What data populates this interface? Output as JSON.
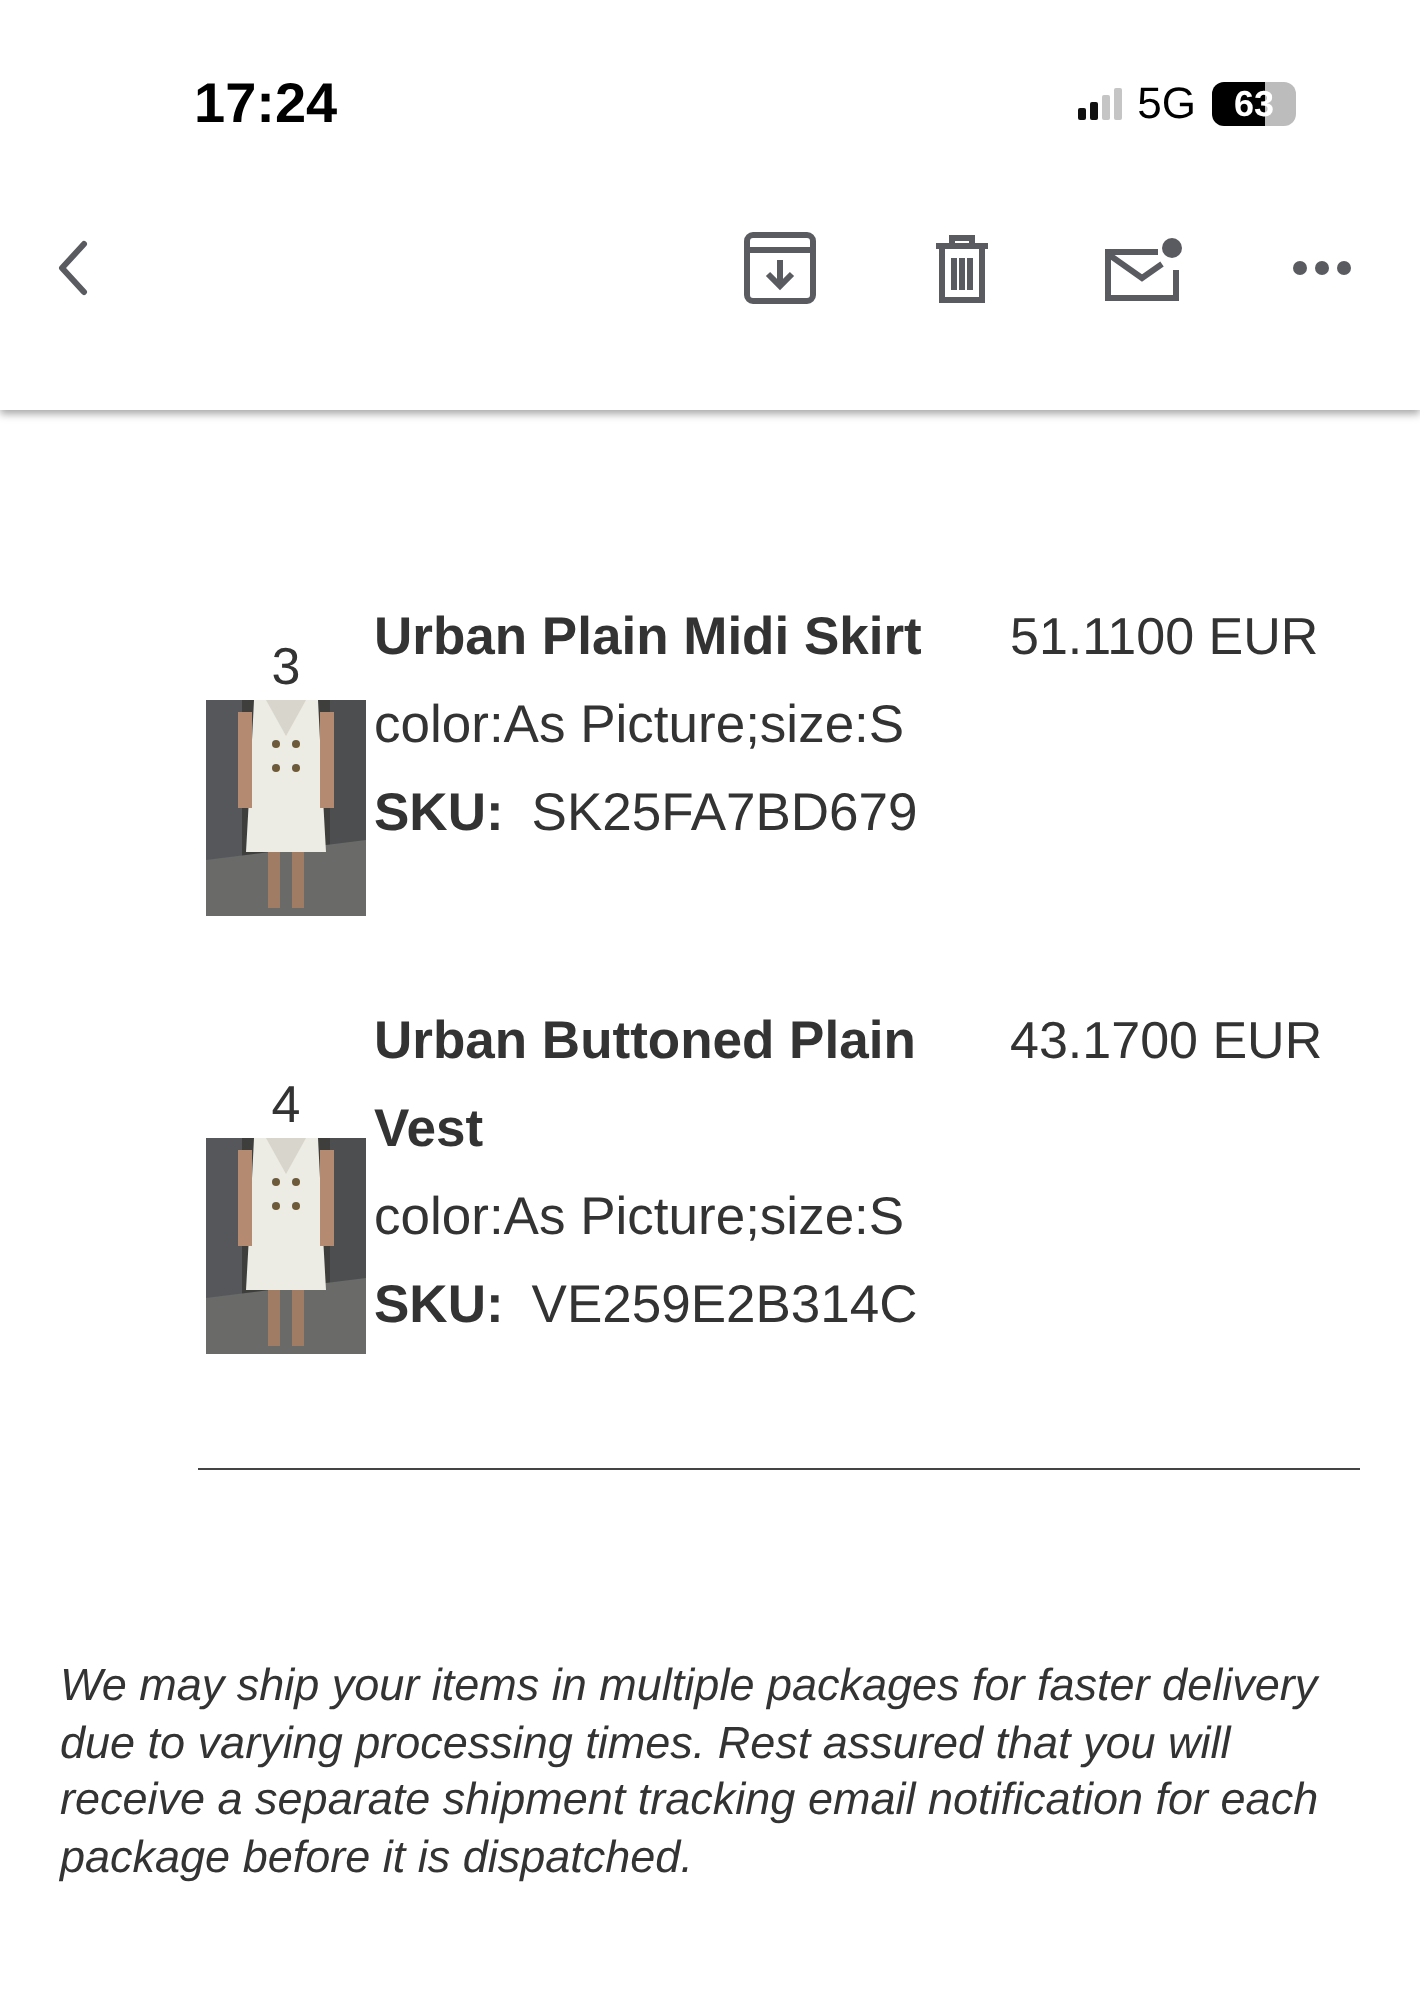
{
  "status_bar": {
    "time": "17:24",
    "network": "5G",
    "battery": "63"
  },
  "toolbar": {
    "actions": [
      {
        "kind": "back"
      },
      {
        "kind": "archive"
      },
      {
        "kind": "trash"
      },
      {
        "kind": "unread"
      },
      {
        "kind": "more"
      }
    ]
  },
  "items": [
    {
      "number": "3",
      "name": "Urban Plain Midi Skirt",
      "price": "51.1100 EUR",
      "variant": "color:As Picture;size:S",
      "sku_label": "SKU:",
      "sku": "SK25FA7BD679"
    },
    {
      "number": "4",
      "name": "Urban Buttoned Plain Vest",
      "price": "43.1700 EUR",
      "variant": "color:As Picture;size:S",
      "sku_label": "SKU:",
      "sku": "VE259E2B314C"
    }
  ],
  "note": "We may ship your items in multiple packages for faster delivery due to varying processing times. Rest assured that you will receive a separate shipment tracking email notification for each package before it is dispatched."
}
